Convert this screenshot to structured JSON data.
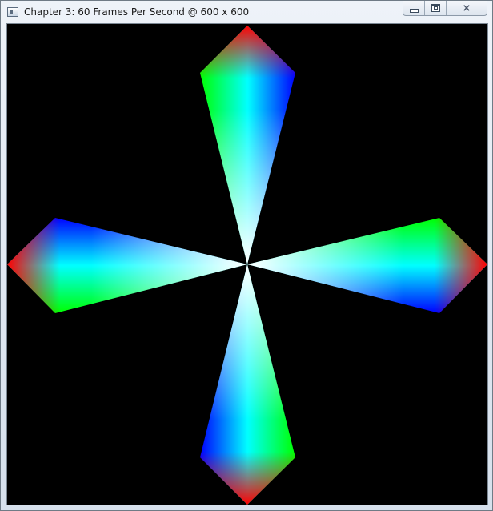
{
  "window": {
    "title": "Chapter 3: 60 Frames Per Second @ 600 x 600",
    "icon": "app-window-icon"
  },
  "caption_buttons": {
    "minimize_icon": "minimize-icon",
    "maximize_icon": "maximize-icon",
    "close_icon": "close-icon",
    "close_glyph": "⨯"
  },
  "scene": {
    "background": "#000000",
    "colors": {
      "tip": "#ff0000",
      "side_a": "#00ff00",
      "side_b": "#0000ff",
      "mid": "#00ffff",
      "center": "#ffffff"
    }
  }
}
